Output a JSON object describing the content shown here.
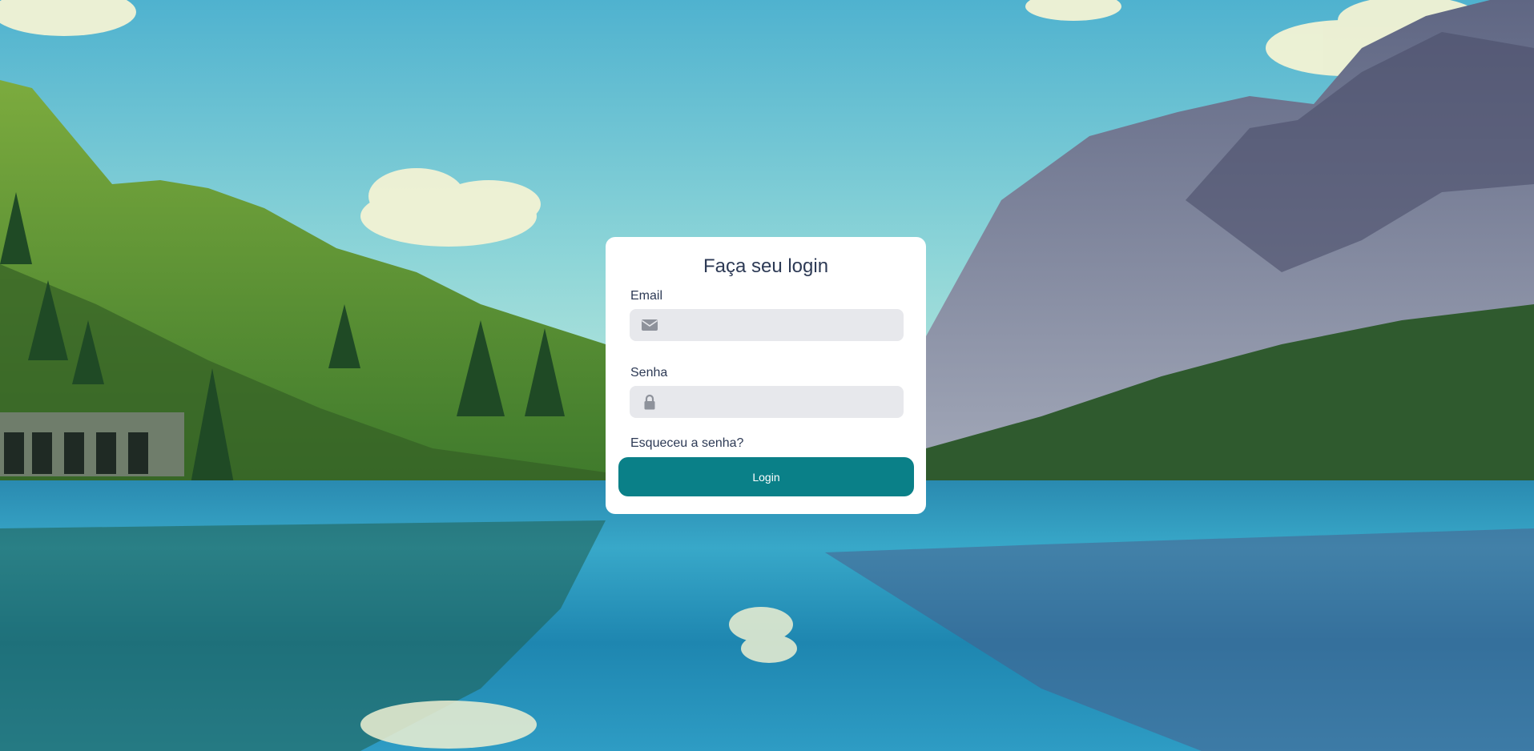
{
  "background": {
    "description_icon": "mountain-lake-landscape"
  },
  "login": {
    "title": "Faça seu login",
    "email": {
      "label": "Email",
      "value": "",
      "placeholder": "",
      "icon": "envelope-icon"
    },
    "password": {
      "label": "Senha",
      "value": "",
      "placeholder": "",
      "icon": "lock-icon"
    },
    "forgot_password": "Esqueceu a senha?",
    "submit_label": "Login"
  },
  "colors": {
    "button": "#0a8088",
    "text": "#2d3a55",
    "input_bg": "#e7e8ec",
    "icon": "#8e929b"
  }
}
